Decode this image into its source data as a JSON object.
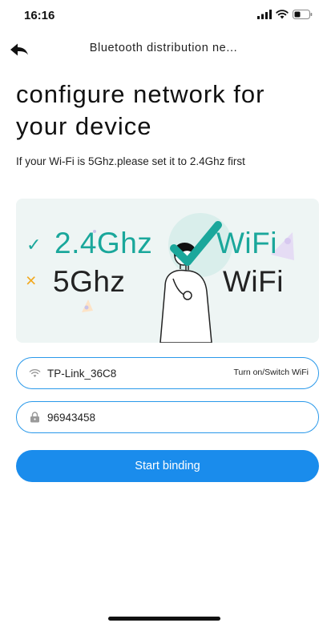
{
  "status_bar": {
    "time": "16:16",
    "signal_icon": "cellular-signal-icon",
    "wifi_icon": "wifi-icon",
    "battery_icon": "battery-icon"
  },
  "nav": {
    "back_icon": "back-arrow-icon",
    "title": "Bluetooth distribution ne..."
  },
  "page": {
    "title": "configure network for your device",
    "subtitle": "If your Wi-Fi is 5Ghz.please set it to 2.4Ghz first"
  },
  "banner": {
    "supported_band": "2.4Ghz",
    "supported_label": "WiFi",
    "unsupported_band": "5Ghz",
    "unsupported_label": "WiFi",
    "check_mark": "✓",
    "cross_mark": "×"
  },
  "wifi_field": {
    "icon": "wifi-icon",
    "value": "TP-Link_36C8",
    "switch_label": "Turn on/Switch WiFi"
  },
  "password_field": {
    "icon": "lock-icon",
    "value": "96943458"
  },
  "actions": {
    "start_label": "Start binding"
  },
  "colors": {
    "accent": "#1a8cec",
    "field_border": "#2a99ea",
    "teal": "#1aa79b",
    "warning": "#f2a81d",
    "banner_bg": "#eef5f4"
  }
}
